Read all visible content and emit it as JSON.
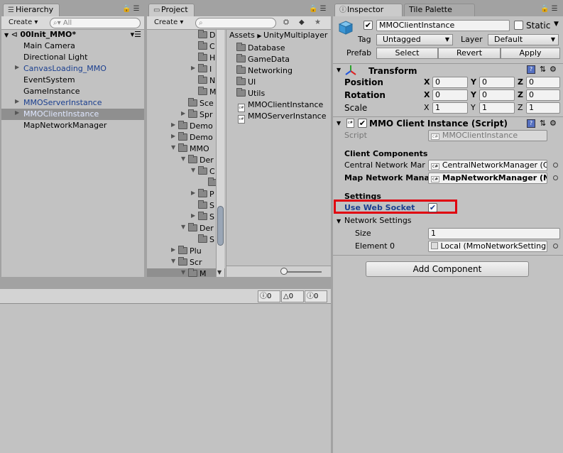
{
  "hierarchy": {
    "tab_label": "Hierarchy",
    "create_label": "Create",
    "search_placeholder": "All",
    "scene_name": "00Init_MMO*",
    "items": [
      {
        "label": "Main Camera"
      },
      {
        "label": "Directional Light"
      },
      {
        "label": "CanvasLoading_MMO"
      },
      {
        "label": "EventSystem"
      },
      {
        "label": "GameInstance"
      },
      {
        "label": "MMOServerInstance"
      },
      {
        "label": "MMOClientInstance"
      },
      {
        "label": "MapNetworkManager"
      }
    ]
  },
  "project": {
    "tab_label": "Project",
    "create_label": "Create",
    "breadcrumb": [
      "Assets",
      "UnityMultiplayer"
    ],
    "tree": [
      "D",
      "C",
      "H",
      "I",
      "N",
      "M",
      "Sce",
      "Spr",
      "Demo",
      "Demo",
      "MMO",
      "Der",
      "C",
      "",
      "P",
      "S",
      "S",
      "Der",
      "S",
      "Plu",
      "Scr",
      "M"
    ],
    "folders": [
      "Database",
      "GameData",
      "Networking",
      "UI",
      "Utils"
    ],
    "files": [
      "MMOClientInstance",
      "MMOServerInstance"
    ]
  },
  "console": {
    "count_info": "0",
    "count_warn": "0",
    "count_error": "0"
  },
  "inspector": {
    "tab_label": "Inspector",
    "tab2_label": "Tile Palette",
    "object_name": "MMOClientInstance",
    "static_label": "Static",
    "tag_label": "Tag",
    "tag_value": "Untagged",
    "layer_label": "Layer",
    "layer_value": "Default",
    "prefab_label": "Prefab",
    "prefab_select": "Select",
    "prefab_revert": "Revert",
    "prefab_apply": "Apply",
    "transform": {
      "title": "Transform",
      "position_label": "Position",
      "rotation_label": "Rotation",
      "scale_label": "Scale",
      "position": [
        "0",
        "0",
        "0"
      ],
      "rotation": [
        "0",
        "0",
        "0"
      ],
      "scale": [
        "1",
        "1",
        "1"
      ]
    },
    "script_component": {
      "title": "MMO Client Instance (Script)",
      "script_label": "Script",
      "script_value": "MMOClientInstance",
      "section1": "Client Components",
      "central_label": "Central Network Mar",
      "central_value": "CentralNetworkManager (C",
      "map_label": "Map Network Mana",
      "map_value": "MapNetworkManager (N",
      "section2": "Settings",
      "websocket_label": "Use Web Socket",
      "network_settings_label": "Network Settings",
      "size_label": "Size",
      "size_value": "1",
      "element0_label": "Element 0",
      "element0_value": "Local (MmoNetworkSetting"
    },
    "add_component_label": "Add Component"
  },
  "axis_labels": {
    "x": "X",
    "y": "Y",
    "z": "Z"
  },
  "colors": {
    "highlight_red": "#e0000f",
    "link_blue": "#1b3f8f"
  }
}
